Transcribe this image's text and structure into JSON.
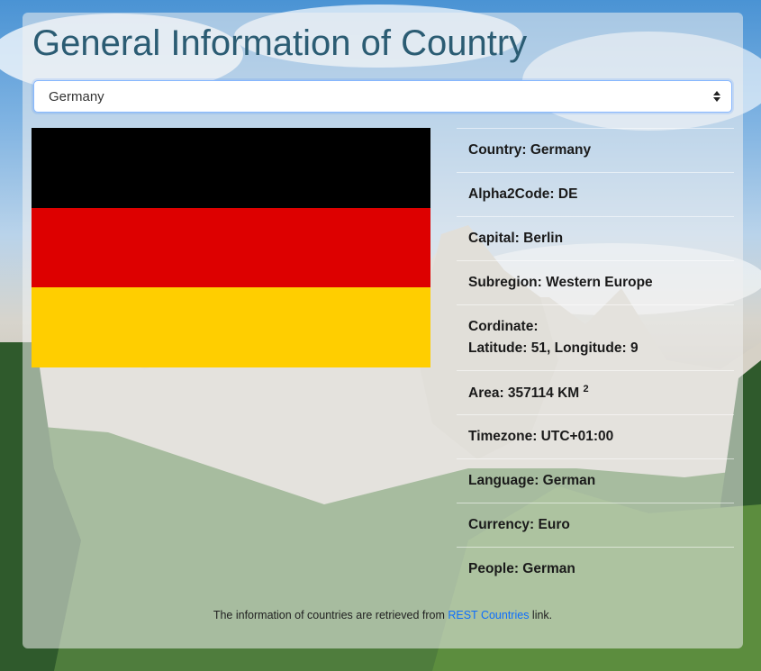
{
  "page": {
    "title": "General Information of Country"
  },
  "country_select": {
    "selected": "Germany"
  },
  "flag": {
    "colors": [
      "#000000",
      "#dd0000",
      "#ffce00"
    ]
  },
  "info": {
    "country": "Country: Germany",
    "alpha2code": "Alpha2Code: DE",
    "capital": "Capital: Berlin",
    "subregion": "Subregion: Western Europe",
    "coordinate_label": "Cordinate:",
    "coordinate_value": "Latitude: 51, Longitude: 9",
    "area_text": "Area: 357114 KM",
    "area_sup": "2",
    "timezone": "Timezone: UTC+01:00",
    "language": "Language: German",
    "currency": "Currency: Euro",
    "people": "People: German"
  },
  "footer": {
    "prefix": "The information of countries are retrieved from ",
    "link_text": "REST Countries",
    "suffix": " link."
  }
}
